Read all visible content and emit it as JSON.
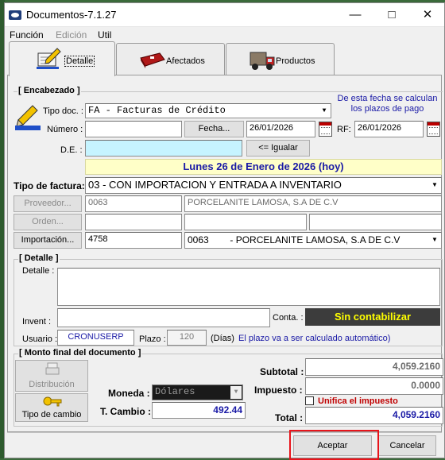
{
  "window": {
    "title": "Documentos-7.1.27"
  },
  "menu": [
    "Función",
    "Edición",
    "Util"
  ],
  "tabs": [
    {
      "label": "Detalle",
      "icon": "document-pen-icon"
    },
    {
      "label": "Afectados",
      "icon": "red-folder-icon"
    },
    {
      "label": "Productos",
      "icon": "truck-icon"
    }
  ],
  "encabezado": {
    "title": "[ Encabezado ]",
    "note": "De esta fecha se calculan\nlos plazos de pago",
    "tipo_doc_label": "Tipo doc. :",
    "tipo_doc_value": "FA - Facturas de Crédito",
    "numero_label": "Número :",
    "numero_value": "",
    "fecha_button": "Fecha...",
    "fecha_value": "26/01/2026",
    "rf_label": "RF:",
    "rf_value": "26/01/2026",
    "de_label": "D.E. :",
    "de_value": "",
    "igualar_button": "<= Igualar",
    "date_banner": "Lunes 26 de Enero de 2026 (hoy)",
    "tipo_factura_label": "Tipo de factura:",
    "tipo_factura_value": "03 - CON IMPORTACION Y ENTRADA A INVENTARIO",
    "proveedor_button": "Proveedor...",
    "proveedor_code": "0063",
    "proveedor_name": "PORCELANITE LAMOSA, S.A DE C.V",
    "orden_button": "Orden...",
    "importacion_button": "Importación...",
    "importacion_value": "4758",
    "importacion_select": "0063        - PORCELANITE LAMOSA, S.A DE C.V"
  },
  "detalle": {
    "title": "[ Detalle ]",
    "detalle_label": "Detalle :",
    "detalle_value": "",
    "invent_label": "Invent :",
    "invent_value": "",
    "conta_label": "Conta. :",
    "conta_status": "Sin contabilizar",
    "usuario_label": "Usuario :",
    "usuario_value": "CRONUSERP",
    "plazo_label": "Plazo :",
    "plazo_value": "120",
    "dias_label": "(Días)",
    "plazo_note": "El plazo va a ser calculado automático)"
  },
  "monto": {
    "title": "[ Monto final del documento ]",
    "distribucion_button": "Distribución",
    "tipo_cambio_button": "Tipo de cambio",
    "moneda_label": "Moneda :",
    "moneda_value": "Dólares",
    "t_cambio_label": "T. Cambio :",
    "t_cambio_value": "492.44",
    "subtotal_label": "Subtotal :",
    "subtotal_value": "4,059.2160",
    "impuesto_label": "Impuesto :",
    "impuesto_value": "0.0000",
    "unifica_label": "Unifica el impuesto",
    "total_label": "Total :",
    "total_value": "4,059.2160"
  },
  "footer": {
    "aceptar_button": "Aceptar",
    "cancelar_button": "Cancelar"
  },
  "colors": {
    "de_field": "#c6f4ff",
    "date_banner_bg": "#ffffc8",
    "conta_bg": "#3c3c3c",
    "conta_text": "#ffff00",
    "blue_text": "#1a1aa6",
    "red_text": "#c00000",
    "highlight": "#e8141b"
  }
}
